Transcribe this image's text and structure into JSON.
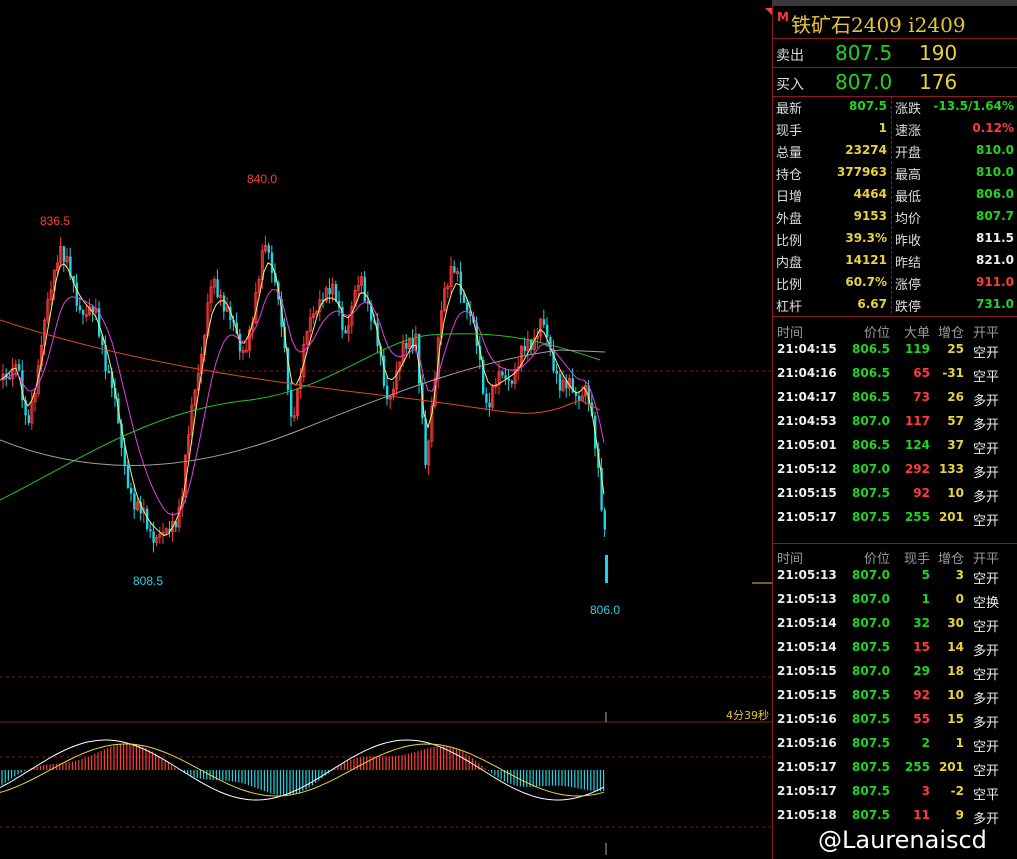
{
  "instrument": {
    "badge": "M",
    "title": "铁矿石2409  i2409"
  },
  "quotes": {
    "sell": {
      "label": "卖出",
      "price": "807.5",
      "volume": "190"
    },
    "buy": {
      "label": "买入",
      "price": "807.0",
      "volume": "176"
    }
  },
  "stats_left": [
    {
      "k": "最新",
      "v": "807.5",
      "c": "g"
    },
    {
      "k": "现手",
      "v": "1",
      "c": "y"
    },
    {
      "k": "总量",
      "v": "23274",
      "c": "y"
    },
    {
      "k": "持仓",
      "v": "377963",
      "c": "y"
    },
    {
      "k": "日增",
      "v": "4464",
      "c": "y"
    },
    {
      "k": "外盘",
      "v": "9153",
      "c": "y"
    },
    {
      "k": "比例",
      "v": "39.3%",
      "c": "y"
    },
    {
      "k": "内盘",
      "v": "14121",
      "c": "y"
    },
    {
      "k": "比例",
      "v": "60.7%",
      "c": "y"
    },
    {
      "k": "杠杆",
      "v": "6.67",
      "c": "y"
    }
  ],
  "stats_right": [
    {
      "k": "涨跌",
      "v": "-13.5/1.64%",
      "c": "g"
    },
    {
      "k": "速涨",
      "v": "0.12%",
      "c": "r"
    },
    {
      "k": "开盘",
      "v": "810.0",
      "c": "g"
    },
    {
      "k": "最高",
      "v": "810.0",
      "c": "g"
    },
    {
      "k": "最低",
      "v": "806.0",
      "c": "g"
    },
    {
      "k": "均价",
      "v": "807.7",
      "c": "g"
    },
    {
      "k": "昨收",
      "v": "811.5",
      "c": "w"
    },
    {
      "k": "昨结",
      "v": "821.0",
      "c": "w"
    },
    {
      "k": "涨停",
      "v": "911.0",
      "c": "r"
    },
    {
      "k": "跌停",
      "v": "731.0",
      "c": "g"
    }
  ],
  "big_orders": {
    "headers": [
      "时间",
      "价位",
      "大单",
      "增仓",
      "开平"
    ],
    "rows": [
      {
        "time": "21:04:15",
        "price": "806.5",
        "qty": "119",
        "qc": "g",
        "chg": "25",
        "type": "空开"
      },
      {
        "time": "21:04:16",
        "price": "806.5",
        "qty": "65",
        "qc": "r",
        "chg": "-31",
        "type": "空平"
      },
      {
        "time": "21:04:17",
        "price": "806.5",
        "qty": "73",
        "qc": "r",
        "chg": "26",
        "type": "多开"
      },
      {
        "time": "21:04:53",
        "price": "807.0",
        "qty": "117",
        "qc": "r",
        "chg": "57",
        "type": "多开"
      },
      {
        "time": "21:05:01",
        "price": "806.5",
        "qty": "124",
        "qc": "g",
        "chg": "37",
        "type": "空开"
      },
      {
        "time": "21:05:12",
        "price": "807.0",
        "qty": "292",
        "qc": "r",
        "chg": "133",
        "type": "多开"
      },
      {
        "time": "21:05:15",
        "price": "807.5",
        "qty": "92",
        "qc": "r",
        "chg": "10",
        "type": "多开"
      },
      {
        "time": "21:05:17",
        "price": "807.5",
        "qty": "255",
        "qc": "g",
        "chg": "201",
        "type": "空开"
      }
    ]
  },
  "ticks": {
    "headers": [
      "时间",
      "价位",
      "现手",
      "增仓",
      "开平"
    ],
    "rows": [
      {
        "time": "21:05:13",
        "price": "807.0",
        "qty": "5",
        "qc": "g",
        "chg": "3",
        "type": "空开"
      },
      {
        "time": "21:05:13",
        "price": "807.0",
        "qty": "1",
        "qc": "g",
        "chg": "0",
        "type": "空换"
      },
      {
        "time": "21:05:14",
        "price": "807.0",
        "qty": "32",
        "qc": "g",
        "chg": "30",
        "type": "空开"
      },
      {
        "time": "21:05:14",
        "price": "807.5",
        "qty": "15",
        "qc": "r",
        "chg": "14",
        "type": "多开"
      },
      {
        "time": "21:05:15",
        "price": "807.0",
        "qty": "29",
        "qc": "g",
        "chg": "18",
        "type": "空开"
      },
      {
        "time": "21:05:15",
        "price": "807.5",
        "qty": "92",
        "qc": "r",
        "chg": "10",
        "type": "多开"
      },
      {
        "time": "21:05:16",
        "price": "807.5",
        "qty": "55",
        "qc": "r",
        "chg": "15",
        "type": "多开"
      },
      {
        "time": "21:05:16",
        "price": "807.5",
        "qty": "2",
        "qc": "g",
        "chg": "1",
        "type": "空开"
      },
      {
        "time": "21:05:17",
        "price": "807.5",
        "qty": "255",
        "qc": "g",
        "chg": "201",
        "type": "空开"
      },
      {
        "time": "21:05:17",
        "price": "807.5",
        "qty": "3",
        "qc": "r",
        "chg": "-2",
        "type": "空平"
      },
      {
        "time": "21:05:18",
        "price": "807.5",
        "qty": "11",
        "qc": "r",
        "chg": "9",
        "type": "多开"
      }
    ]
  },
  "chart_labels": {
    "high1": "836.5",
    "high2": "840.0",
    "low1": "808.5",
    "low2": "806.0",
    "countdown": "4分39秒"
  },
  "watermark": "@Laurenaiscd",
  "colors": {
    "up": "#ff3b3b",
    "down": "#21d4e4",
    "panel_line": "#8a1c1c",
    "yellow": "#e8d33c",
    "green": "#21d421"
  }
}
